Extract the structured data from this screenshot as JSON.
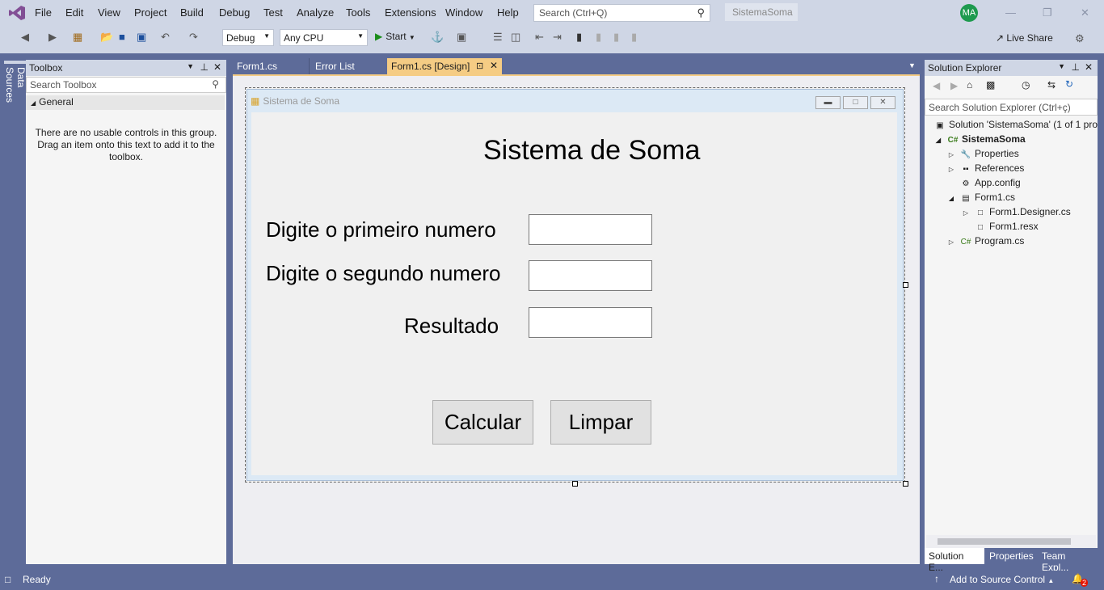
{
  "menu": [
    "File",
    "Edit",
    "View",
    "Project",
    "Build",
    "Debug",
    "Test",
    "Analyze",
    "Tools",
    "Extensions",
    "Window",
    "Help"
  ],
  "search": {
    "placeholder": "Search (Ctrl+Q)"
  },
  "solution_name": "SistemaSoma",
  "avatar": "MA",
  "toolbar": {
    "config": "Debug",
    "platform": "Any CPU",
    "start": "Start",
    "live_share": "Live Share"
  },
  "data_sources": "Data Sources",
  "toolbox": {
    "title": "Toolbox",
    "search": "Search Toolbox",
    "group": "General",
    "empty": "There are no usable controls in this group. Drag an item onto this text to add it to the toolbox."
  },
  "tabs": [
    "Form1.cs",
    "Error List",
    "Form1.cs [Design]"
  ],
  "form": {
    "window_title": "Sistema de Soma",
    "heading": "Sistema de Soma",
    "label1": "Digite o primeiro numero",
    "label2": "Digite o segundo numero",
    "label3": "Resultado",
    "calc": "Calcular",
    "clear": "Limpar"
  },
  "solution_explorer": {
    "title": "Solution Explorer",
    "search": "Search Solution Explorer (Ctrl+ç)",
    "solution": "Solution 'SistemaSoma' (1 of 1 pro",
    "project": "SistemaSoma",
    "properties": "Properties",
    "references": "References",
    "appconfig": "App.config",
    "form1": "Form1.cs",
    "designer": "Form1.Designer.cs",
    "resx": "Form1.resx",
    "program": "Program.cs"
  },
  "bottom_tabs": [
    "Solution E...",
    "Properties",
    "Team Expl..."
  ],
  "status": {
    "ready": "Ready",
    "source_control": "Add to Source Control",
    "notifications": "2"
  }
}
